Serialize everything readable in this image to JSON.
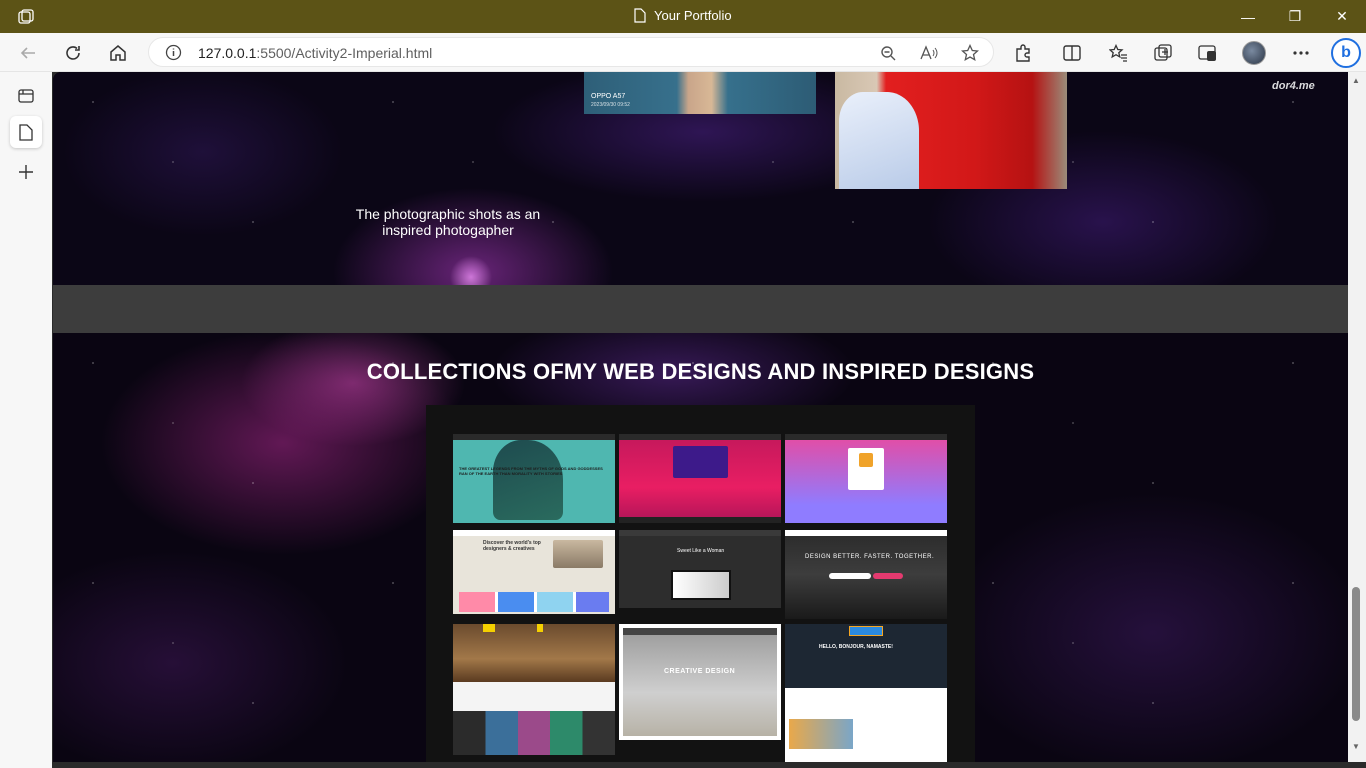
{
  "window": {
    "title": "Your Portfolio",
    "minimize_glyph": "—",
    "maximize_glyph": "❐",
    "close_glyph": "✕"
  },
  "toolbar": {
    "url_host": "127.0.0.1",
    "url_rest": ":5500/Activity2-Imperial.html"
  },
  "page": {
    "photo1_caption": "OPPO A57",
    "photo1_subcaption": "2023/09/30 09:52",
    "watermark": "dor4.me",
    "photo_caption": "The photographic shots as an inspired photogapher",
    "section_heading": "COLLECTIONS OFMY WEB DESIGNS AND INSPIRED DESIGNS",
    "thumbs": {
      "t1": "THE GREATEST LEGENDS FROM THE MYTHS OF GODS AND GODDESSES RAN OF THE EARTH THAN MORALITY WITH STORIES",
      "t4": "Discover the world's top designers & creatives",
      "t5": "Sweet Like a Woman",
      "t6": "DESIGN BETTER. FASTER. TOGETHER.",
      "t8": "CREATIVE DESIGN",
      "t9": "HELLO, BONJOUR, NAMASTE!"
    }
  },
  "colors": {
    "titlebar": "#5c5316",
    "heading": "#ffffff",
    "gray_band": "#3d3d3d"
  },
  "icons": [
    "app-icon",
    "back-icon",
    "refresh-icon",
    "home-icon",
    "info-icon",
    "zoom-icon",
    "read-aloud-icon",
    "favorite-star-icon",
    "extensions-icon",
    "split-screen-icon",
    "favorites-icon",
    "collections-icon",
    "browser-essentials-icon",
    "profile-avatar",
    "more-icon",
    "bing-icon",
    "tabs-icon",
    "page-icon",
    "new-tab-icon"
  ]
}
